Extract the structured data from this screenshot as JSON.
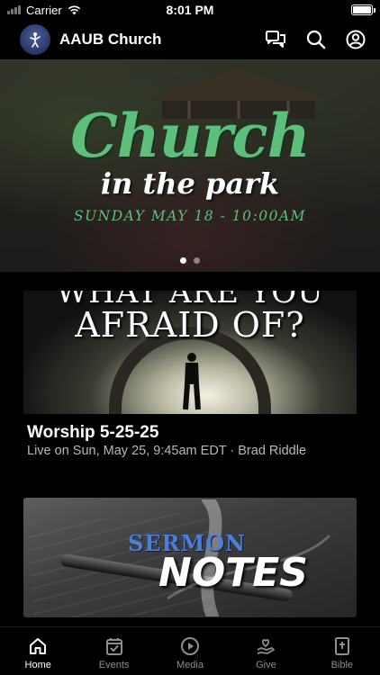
{
  "status_bar": {
    "carrier": "Carrier",
    "time": "8:01 PM"
  },
  "header": {
    "app_name": "AAUB Church",
    "icons": [
      "chat-icon",
      "search-icon",
      "profile-icon"
    ]
  },
  "hero": {
    "title": "Church",
    "subtitle": "in the park",
    "date": "SUNDAY MAY 18 - 10:00AM",
    "pagination": {
      "total": 2,
      "active": 1
    }
  },
  "sermon_card": {
    "thumb_line1": "WHAT ARE YOU",
    "thumb_line2": "AFRAID OF?",
    "title": "Worship 5-25-25",
    "subtitle": "Live on Sun, May 25, 9:45am EDT · Brad Riddle"
  },
  "notes_card": {
    "word1": "SERMON",
    "word2": "NOTES"
  },
  "tabs": [
    {
      "label": "Home",
      "icon": "home-icon",
      "active": true
    },
    {
      "label": "Events",
      "icon": "calendar-check-icon",
      "active": false
    },
    {
      "label": "Media",
      "icon": "play-circle-icon",
      "active": false
    },
    {
      "label": "Give",
      "icon": "hand-heart-icon",
      "active": false
    },
    {
      "label": "Bible",
      "icon": "bible-icon",
      "active": false
    }
  ],
  "colors": {
    "background": "#000000",
    "accent_green": "#5cc07a",
    "notes_blue": "#4d7fd6",
    "tab_inactive": "#8e8e93"
  }
}
